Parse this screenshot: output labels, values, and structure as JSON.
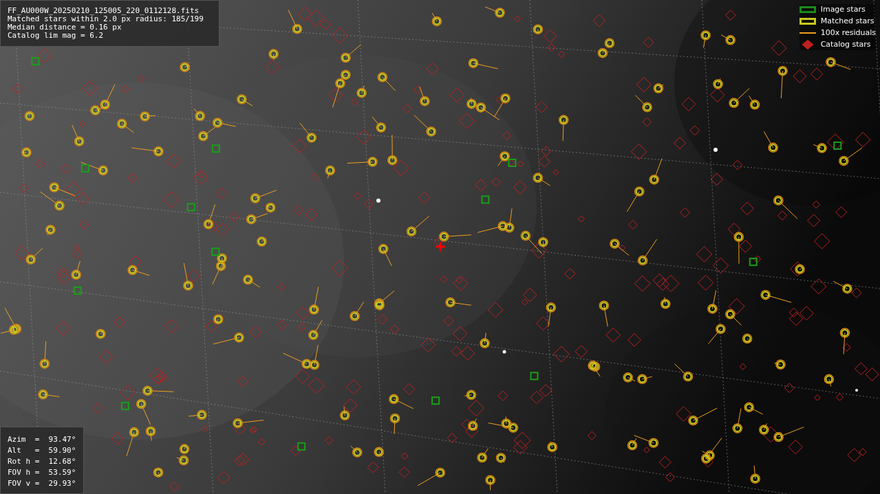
{
  "file_info": {
    "lines": [
      "FF_AU000W_20250210_125005_220_0112128.fits",
      "Matched stars within 2.0 px radius: 185/199",
      "Median distance = 0.16 px",
      "Catalog lim mag = 6.2"
    ]
  },
  "legend": [
    {
      "kind": "box",
      "color": "#1a8a1a",
      "label": "Image stars"
    },
    {
      "kind": "box",
      "color": "#c8c820",
      "label": "Matched stars"
    },
    {
      "kind": "line",
      "color": "#f0a020",
      "label": "100x residuals"
    },
    {
      "kind": "diamond",
      "color": "#c02020",
      "label": "Catalog stars"
    }
  ],
  "pointing": {
    "lines": [
      "Azim  =  93.47°",
      "Alt   =  59.90°",
      "Rot h =  12.68°",
      "FOV h =  53.59°",
      "FOV v =  29.93°"
    ]
  }
}
